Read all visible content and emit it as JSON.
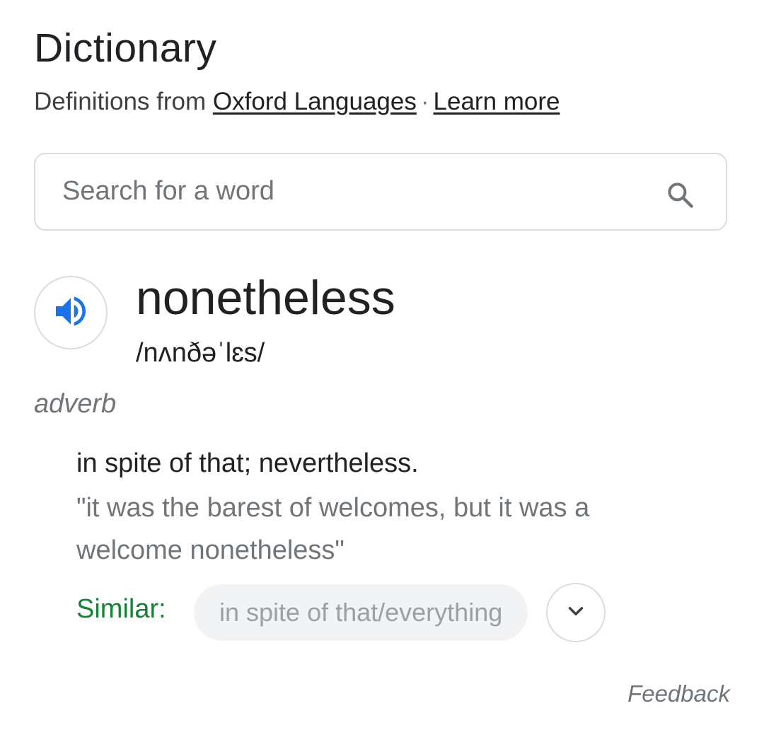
{
  "header": {
    "title": "Dictionary",
    "source_prefix": "Definitions from",
    "source_link": "Oxford Languages",
    "separator": "·",
    "learn_more": "Learn more"
  },
  "search": {
    "placeholder": "Search for a word",
    "icon": "search-icon"
  },
  "entry": {
    "speaker_icon": "speaker-icon",
    "word": "nonetheless",
    "phonetic": "/nʌnðəˈlɛs/",
    "part_of_speech": "adverb",
    "definition": "in spite of that; nevertheless.",
    "example": "\"it was the barest of welcomes, but it was a welcome nonetheless\"",
    "similar_label": "Similar:",
    "similar_chip": "in spite of that/everything",
    "expand_icon": "chevron-down-icon"
  },
  "footer": {
    "feedback": "Feedback"
  },
  "colors": {
    "accent_blue": "#1a73e8",
    "similar_green": "#188038",
    "border": "#dadce0",
    "chip_bg": "#f1f3f4"
  }
}
